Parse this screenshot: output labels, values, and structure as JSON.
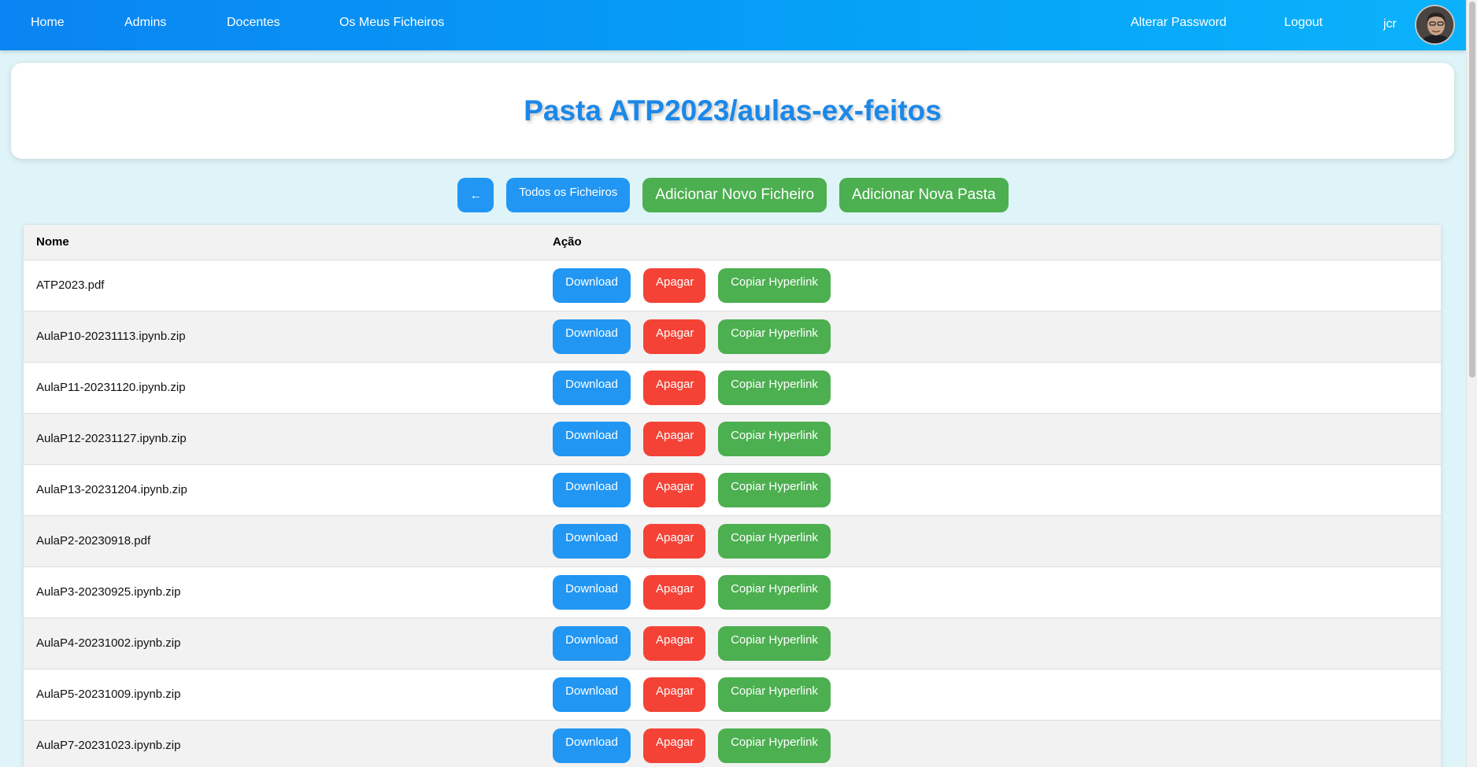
{
  "nav": {
    "home": "Home",
    "admins": "Admins",
    "docentes": "Docentes",
    "meus_ficheiros": "Os Meus Ficheiros",
    "alterar_password": "Alterar Password",
    "logout": "Logout",
    "user": "jcr"
  },
  "header": {
    "title": "Pasta ATP2023/aulas-ex-feitos"
  },
  "toolbar": {
    "back_label": "←",
    "todos_label": "Todos os Ficheiros",
    "add_file_label": "Adicionar Novo Ficheiro",
    "add_folder_label": "Adicionar Nova Pasta"
  },
  "table": {
    "columns": [
      "Nome",
      "Ação"
    ],
    "actions": {
      "download": "Download",
      "apagar": "Apagar",
      "copiar": "Copiar Hyperlink"
    },
    "rows": [
      "ATP2023.pdf",
      "AulaP10-20231113.ipynb.zip",
      "AulaP11-20231120.ipynb.zip",
      "AulaP12-20231127.ipynb.zip",
      "AulaP13-20231204.ipynb.zip",
      "AulaP2-20230918.pdf",
      "AulaP3-20230925.ipynb.zip",
      "AulaP4-20231002.ipynb.zip",
      "AulaP5-20231009.ipynb.zip",
      "AulaP7-20231023.ipynb.zip"
    ]
  },
  "colors": {
    "primary_blue": "#2196f3",
    "danger_red": "#f44336",
    "success_green": "#4caf50",
    "title_blue": "#1b88e8"
  }
}
